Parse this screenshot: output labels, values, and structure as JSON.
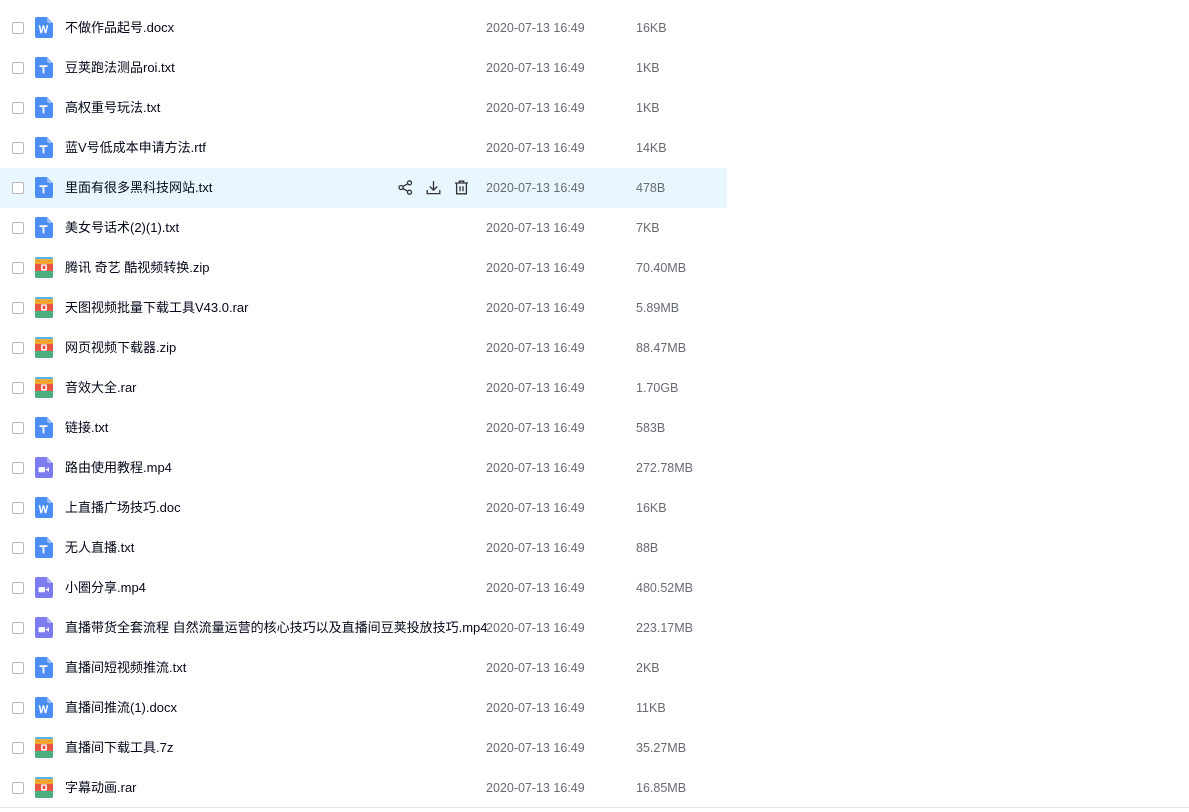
{
  "files": [
    {
      "name": "不做作品起号.docx",
      "date": "2020-07-13 16:49",
      "size": "16KB",
      "type": "word",
      "type_icon": "word-doc-icon"
    },
    {
      "name": "豆荚跑法测品roi.txt",
      "date": "2020-07-13 16:49",
      "size": "1KB",
      "type": "txt",
      "type_icon": "text-file-icon"
    },
    {
      "name": "高权重号玩法.txt",
      "date": "2020-07-13 16:49",
      "size": "1KB",
      "type": "txt",
      "type_icon": "text-file-icon"
    },
    {
      "name": "蓝V号低成本申请方法.rtf",
      "date": "2020-07-13 16:49",
      "size": "14KB",
      "type": "txt",
      "type_icon": "text-file-icon"
    },
    {
      "name": "里面有很多黑科技网站.txt",
      "date": "2020-07-13 16:49",
      "size": "478B",
      "type": "txt",
      "type_icon": "text-file-icon",
      "hovered": true
    },
    {
      "name": "美女号话术(2)(1).txt",
      "date": "2020-07-13 16:49",
      "size": "7KB",
      "type": "txt",
      "type_icon": "text-file-icon"
    },
    {
      "name": "腾讯 奇艺 酷视频转换.zip",
      "date": "2020-07-13 16:49",
      "size": "70.40MB",
      "type": "archive",
      "type_icon": "archive-file-icon"
    },
    {
      "name": "天图视频批量下载工具V43.0.rar",
      "date": "2020-07-13 16:49",
      "size": "5.89MB",
      "type": "archive",
      "type_icon": "archive-file-icon"
    },
    {
      "name": "网页视频下载器.zip",
      "date": "2020-07-13 16:49",
      "size": "88.47MB",
      "type": "archive",
      "type_icon": "archive-file-icon"
    },
    {
      "name": "音效大全.rar",
      "date": "2020-07-13 16:49",
      "size": "1.70GB",
      "type": "archive",
      "type_icon": "archive-file-icon"
    },
    {
      "name": "链接.txt",
      "date": "2020-07-13 16:49",
      "size": "583B",
      "type": "txt",
      "type_icon": "text-file-icon"
    },
    {
      "name": "路由使用教程.mp4",
      "date": "2020-07-13 16:49",
      "size": "272.78MB",
      "type": "video",
      "type_icon": "video-file-icon"
    },
    {
      "name": "上直播广场技巧.doc",
      "date": "2020-07-13 16:49",
      "size": "16KB",
      "type": "word",
      "type_icon": "word-doc-icon"
    },
    {
      "name": "无人直播.txt",
      "date": "2020-07-13 16:49",
      "size": "88B",
      "type": "txt",
      "type_icon": "text-file-icon"
    },
    {
      "name": "小圈分享.mp4",
      "date": "2020-07-13 16:49",
      "size": "480.52MB",
      "type": "video",
      "type_icon": "video-file-icon"
    },
    {
      "name": "直播带货全套流程  自然流量运营的核心技巧以及直播间豆荚投放技巧.mp4",
      "date": "2020-07-13 16:49",
      "size": "223.17MB",
      "type": "video",
      "type_icon": "video-file-icon"
    },
    {
      "name": "直播间短视频推流.txt",
      "date": "2020-07-13 16:49",
      "size": "2KB",
      "type": "txt",
      "type_icon": "text-file-icon"
    },
    {
      "name": "直播间推流(1).docx",
      "date": "2020-07-13 16:49",
      "size": "11KB",
      "type": "word",
      "type_icon": "word-doc-icon"
    },
    {
      "name": "直播间下载工具.7z",
      "date": "2020-07-13 16:49",
      "size": "35.27MB",
      "type": "archive",
      "type_icon": "archive-file-icon"
    },
    {
      "name": "字幕动画.rar",
      "date": "2020-07-13 16:49",
      "size": "16.85MB",
      "type": "archive",
      "type_icon": "archive-file-icon"
    }
  ],
  "row_actions": [
    {
      "icon": "share-icon"
    },
    {
      "icon": "download-icon"
    },
    {
      "icon": "delete-icon"
    }
  ],
  "colors": {
    "hover_row": "#e8f6fd",
    "icon_blue": "#4c8df6",
    "icon_purple": "#7b7cf0",
    "text_primary": "#03081a",
    "text_secondary": "#666a73"
  }
}
